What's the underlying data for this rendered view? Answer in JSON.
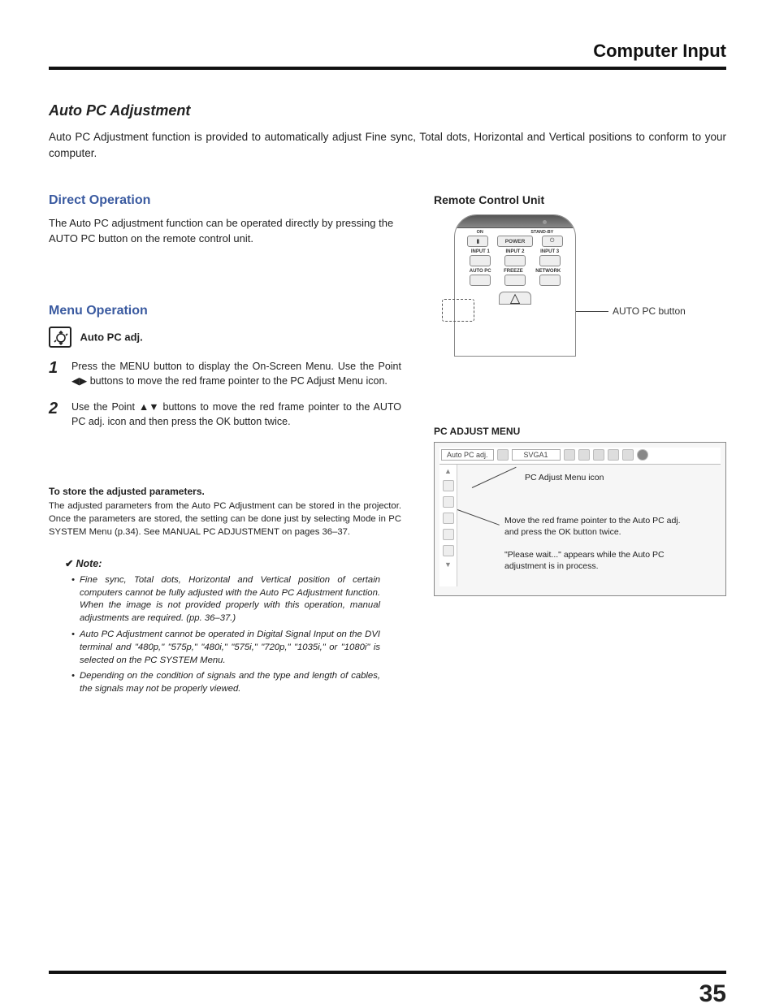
{
  "header": {
    "title": "Computer Input"
  },
  "section": {
    "title": "Auto PC Adjustment",
    "intro": "Auto PC Adjustment function is provided to automatically adjust Fine sync, Total dots, Horizontal and Vertical positions to conform to your computer."
  },
  "direct": {
    "heading": "Direct Operation",
    "text": "The Auto PC adjustment function can be operated directly by pressing the AUTO PC button on the remote control unit."
  },
  "remote": {
    "heading": "Remote Control Unit",
    "labels": {
      "on": "ON",
      "standby": "STAND-BY",
      "power": "POWER",
      "input1": "INPUT 1",
      "input2": "INPUT 2",
      "input3": "INPUT 3",
      "autopc": "AUTO PC",
      "freeze": "FREEZE",
      "network": "NETWORK"
    },
    "callout": "AUTO PC button"
  },
  "menu": {
    "heading": "Menu Operation",
    "icon_label": "Auto PC adj.",
    "steps": [
      {
        "num": "1",
        "text_pre": "Press the MENU button to display the On-Screen Menu. Use the Point ",
        "text_post": " buttons to move the red frame pointer to the PC Adjust Menu icon."
      },
      {
        "num": "2",
        "text_pre": "Use the Point ",
        "text_post": " buttons to move the red frame pointer to the AUTO PC adj. icon and then press the OK button twice."
      }
    ]
  },
  "store": {
    "heading": "To store the adjusted parameters.",
    "text": "The adjusted parameters from the Auto PC Adjustment can be stored in the projector. Once the parameters are stored, the setting can be done just by selecting Mode in PC SYSTEM Menu (p.34). See MANUAL PC ADJUSTMENT on pages 36–37."
  },
  "note": {
    "heading": "Note:",
    "items": [
      "Fine sync, Total dots, Horizontal and Vertical position of certain computers cannot be fully adjusted with the Auto PC Adjustment function. When the image is not provided properly with this operation, manual adjustments are required. (pp. 36–37.)",
      "Auto PC Adjustment cannot be operated in Digital Signal Input on the DVI terminal and \"480p,\" \"575p,\" \"480i,\" \"575i,\" \"720p,\" \"1035i,\" or \"1080i\" is selected on the PC SYSTEM Menu.",
      "Depending on the condition of signals and the type and length of cables, the signals may not be properly viewed."
    ]
  },
  "pcmenu": {
    "heading": "PC ADJUST MENU",
    "top_label": "Auto PC adj.",
    "mode": "SVGA1",
    "callouts": {
      "c1": "PC Adjust Menu icon",
      "c2": "Move the red frame pointer to the Auto PC adj. and press the OK button twice.",
      "c3": "\"Please wait...\" appears while the Auto PC adjustment is in process."
    }
  },
  "page_number": "35"
}
